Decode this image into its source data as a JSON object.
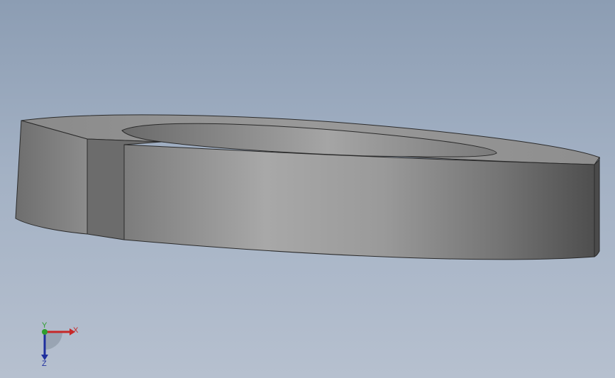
{
  "viewport": {
    "background_top": "#8c9db3",
    "background_bottom": "#b6c0cf",
    "model_color": "#808080",
    "edge_color": "#2a2a2a"
  },
  "triad": {
    "x_label": "X",
    "y_label": "Y",
    "z_label": "Z",
    "x_color": "#c62828",
    "y_color": "#2e9e2e",
    "z_color": "#1f2f9e"
  }
}
